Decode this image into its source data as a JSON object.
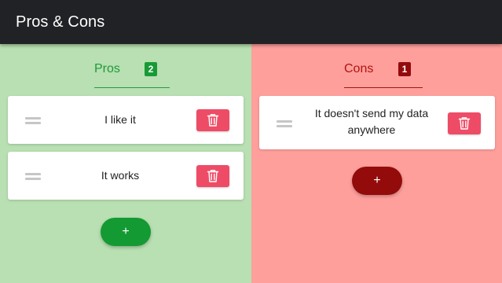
{
  "app": {
    "title": "Pros & Cons"
  },
  "columns": {
    "pros": {
      "title": "Pros",
      "count": "2",
      "accent_color": "#1e9a3c",
      "background_color": "#b8e0b2",
      "add_label": "+",
      "items": [
        {
          "text": "I like it"
        },
        {
          "text": "It works"
        }
      ]
    },
    "cons": {
      "title": "Cons",
      "count": "1",
      "accent_color": "#b0140d",
      "background_color": "#ff9f9c",
      "add_label": "+",
      "items": [
        {
          "text": "It doesn't send my data anywhere"
        }
      ]
    }
  },
  "icons": {
    "delete": "trash-icon",
    "drag": "drag-handle-icon"
  },
  "colors": {
    "topbar": "#212225",
    "delete_button": "#ee4c66"
  }
}
